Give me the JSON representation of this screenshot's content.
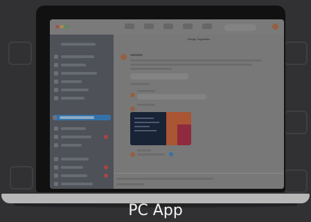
{
  "caption": "PC App",
  "screen": {
    "chat_title": "Design Sugestões"
  },
  "colors": {
    "accent": "#3d86c6",
    "badge": "#c85050",
    "caption_text": "#f2f2f2"
  }
}
